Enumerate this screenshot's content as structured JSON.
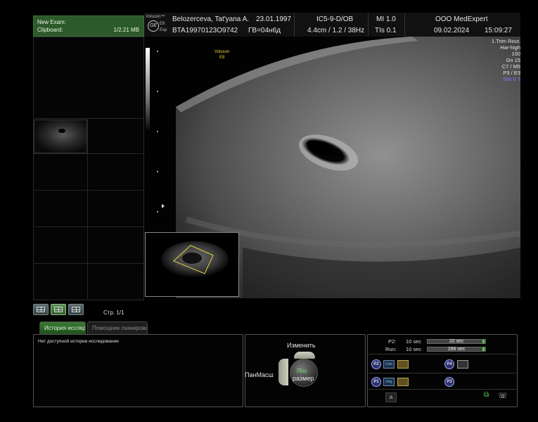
{
  "exam": {
    "title": "New Exam:",
    "clipboard_label": "Clipboard:",
    "clipboard_size": "1/2.21 MB"
  },
  "header": {
    "vendor": "Voluson™",
    "mode": "E8",
    "expert": "Exp",
    "logo": "GE",
    "patient_name": "Belozerceva, Tat'yana A.",
    "birth_date": "23.01.1997",
    "probe": "IC5-9-D/OB",
    "mi": "MI 1.0",
    "clinic": "OOO MedExpert",
    "patient_id": "BTA19970123O9742",
    "ga": "ГВ=04н6д",
    "depth_info": "4.4cm / 1.2 / 38Hz",
    "tis": "TIs 0.1",
    "date": "09.02.2024",
    "time": "15:09:27"
  },
  "image_overlay": {
    "label_line1": "Voluson",
    "label_line2": "E8"
  },
  "settings": [
    "1.Trim Rout.",
    "Har-high",
    "100",
    "Gn 15",
    "C7 / M5",
    "P3 / E3"
  ],
  "settings_sri": "SRI II 3",
  "pages": "Стр. 1/1",
  "tabs": {
    "history": "История исследований",
    "assistant": "Помощник сканирования"
  },
  "history_empty": "Нет доступной истории исследования",
  "trackball": {
    "change": "Изменить",
    "pan": "ПанМасш",
    "title": "Поз.",
    "size": "размер"
  },
  "cine": {
    "p2_label": "P2:",
    "p2_time": "10 sec",
    "p2_value": "20 sec",
    "run_label": "Run:",
    "run_time": "10 sec",
    "run_value": "288 sec",
    "buttons": [
      "P2",
      "P4",
      "P1",
      "P3"
    ],
    "cine_icon": "Cine",
    "img_icon": "Img",
    "letter": "a"
  }
}
